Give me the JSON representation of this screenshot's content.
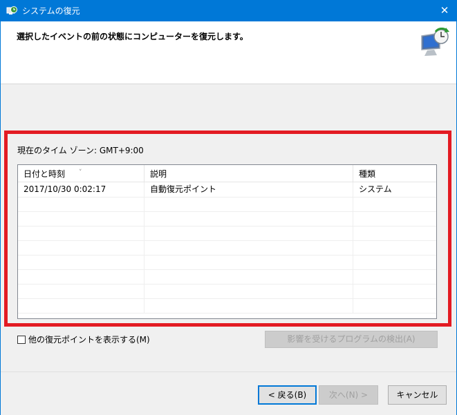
{
  "window": {
    "title": "システムの復元",
    "close_symbol": "✕"
  },
  "header": {
    "heading": "選択したイベントの前の状態にコンピューターを復元します。"
  },
  "timezone_text": "現在のタイム ゾーン: GMT+9:00",
  "table": {
    "columns": [
      "日付と時刻",
      "説明",
      "種類"
    ],
    "sort_indicator": "˅",
    "rows": [
      {
        "datetime": "2017/10/30 0:02:17",
        "description": "自動復元ポイント",
        "type": "システム"
      }
    ]
  },
  "show_more_checkbox": {
    "label": "他の復元ポイントを表示する(M)",
    "checked": false
  },
  "buttons": {
    "scan": "影響を受けるプログラムの検出(A)",
    "back": "< 戻る(B)",
    "next": "次へ(N) >",
    "cancel": "キャンセル"
  },
  "colors": {
    "titlebar": "#0078d7",
    "highlight_border": "#e31b23"
  },
  "icons": {
    "app": "system-restore-icon",
    "header": "system-restore-monitor-icon"
  }
}
